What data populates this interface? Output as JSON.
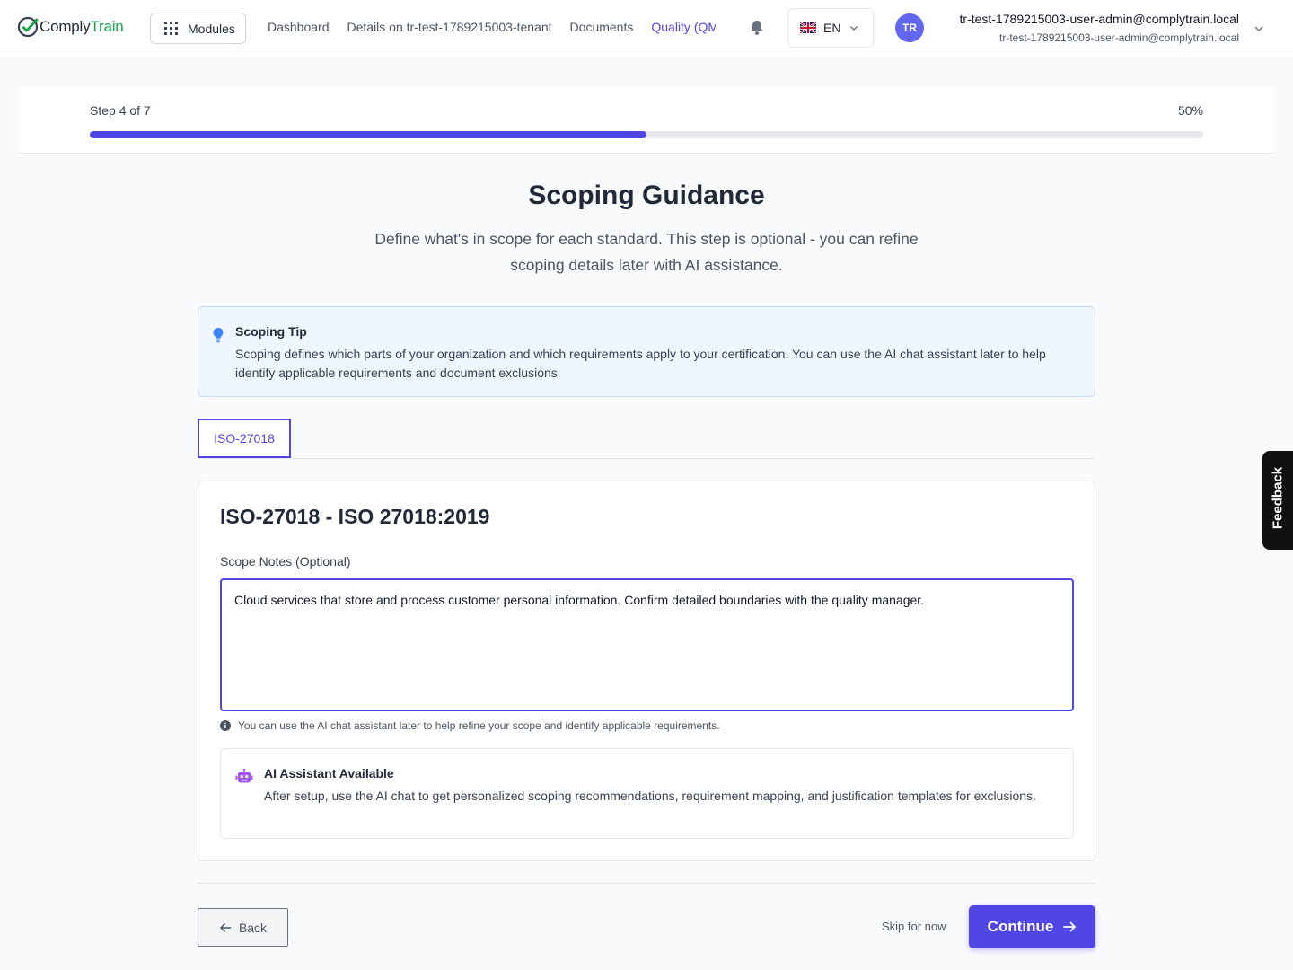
{
  "header": {
    "logo_prefix": "Comply",
    "logo_suffix": "Train",
    "modules_label": "Modules",
    "nav": [
      {
        "label": "Dashboard"
      },
      {
        "label": "Details on tr-test-1789215003-tenant"
      },
      {
        "label": "Documents"
      },
      {
        "label": "Quality (QMS)",
        "active": true
      }
    ],
    "language": "EN",
    "avatar_initials": "TR",
    "user_name": "tr-test-1789215003-user-admin@complytrain.local",
    "user_email": "tr-test-1789215003-user-admin@complytrain.local"
  },
  "progress": {
    "step_label": "Step 4 of 7",
    "percent_label": "50%",
    "percent": 50
  },
  "page": {
    "title": "Scoping Guidance",
    "subtitle": "Define what's in scope for each standard. This step is optional - you can refine scoping details later with AI assistance."
  },
  "tip": {
    "title": "Scoping Tip",
    "text": "Scoping defines which parts of your organization and which requirements apply to your certification. You can use the AI chat assistant later to help identify applicable requirements and document exclusions."
  },
  "tabs": [
    {
      "label": "ISO-27018",
      "active": true
    }
  ],
  "standard": {
    "title": "ISO-27018 - ISO 27018:2019",
    "notes_label": "Scope Notes (Optional)",
    "notes_value": "Cloud services that store and process customer personal information. Confirm detailed boundaries with the quality manager.",
    "hint": "You can use the AI chat assistant later to help refine your scope and identify applicable requirements.",
    "ai_title": "AI Assistant Available",
    "ai_text": "After setup, use the AI chat to get personalized scoping recommendations, requirement mapping, and justification templates for exclusions."
  },
  "footer": {
    "back_label": "Back",
    "skip_label": "Skip for now",
    "continue_label": "Continue"
  },
  "feedback_label": "Feedback",
  "colors": {
    "accent": "#4f46e5",
    "brand_green": "#16a34a",
    "tip_bg": "#eff6ff"
  },
  "icons": {
    "logo": "check-circle-icon",
    "modules": "grid-icon",
    "notifications": "bell-icon",
    "flag": "uk-flag-icon",
    "tip": "lightbulb-icon",
    "hint": "info-icon",
    "ai": "robot-icon",
    "back": "arrow-left-icon",
    "continue": "arrow-right-icon"
  }
}
